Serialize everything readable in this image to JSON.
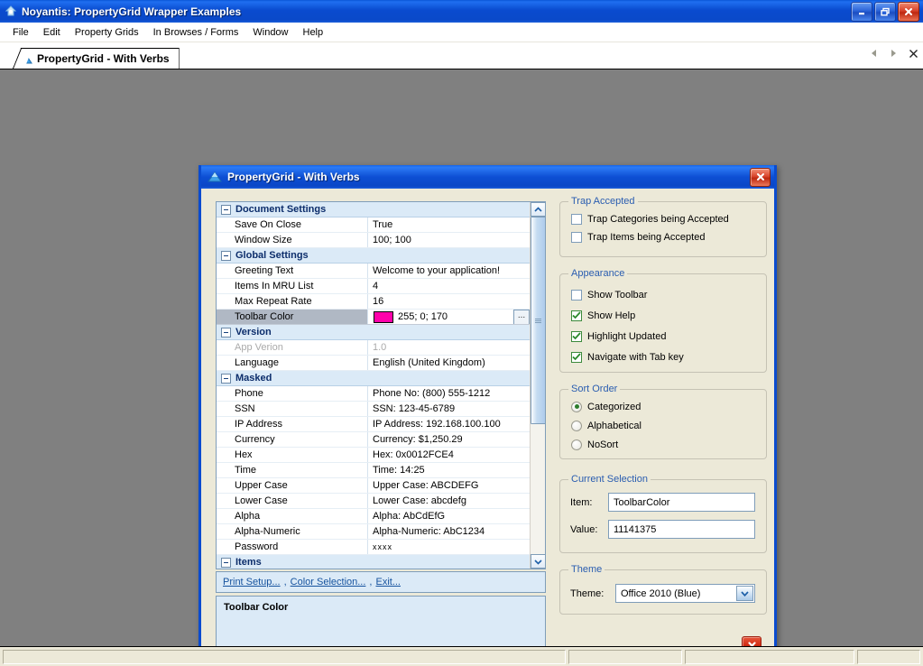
{
  "window": {
    "title": "Noyantis: PropertyGrid Wrapper Examples",
    "icon": "app-icon",
    "buttons": {
      "minimize": "minimize",
      "restore": "restore",
      "close": "close"
    }
  },
  "menubar": {
    "items": [
      {
        "label": "File"
      },
      {
        "label": "Edit"
      },
      {
        "label": "Property Grids"
      },
      {
        "label": "In Browses / Forms"
      },
      {
        "label": "Window"
      },
      {
        "label": "Help"
      }
    ]
  },
  "tabstrip": {
    "tabs": [
      {
        "label": "PropertyGrid - With Verbs",
        "icon": "triangle-icon",
        "active": true
      }
    ],
    "nav": {
      "prev": "prev-arrow-icon",
      "next": "next-arrow-icon",
      "close": "close-icon"
    }
  },
  "dialog": {
    "title": "PropertyGrid - With Verbs",
    "icon": "triangle-icon",
    "close_label": "close",
    "propertygrid": {
      "rows": [
        {
          "type": "category",
          "name": "Document Settings"
        },
        {
          "type": "item",
          "name": "Save On Close",
          "value": "True"
        },
        {
          "type": "item",
          "name": "Window Size",
          "value": "100; 100"
        },
        {
          "type": "category",
          "name": "Global Settings"
        },
        {
          "type": "item",
          "name": "Greeting Text",
          "value": "Welcome to your application!"
        },
        {
          "type": "item",
          "name": "Items In MRU List",
          "value": "4"
        },
        {
          "type": "item",
          "name": "Max Repeat Rate",
          "value": "16"
        },
        {
          "type": "item",
          "name": "Toolbar Color",
          "value": "255; 0; 170",
          "selected": true,
          "swatch": "#FF00AA",
          "editor": "..."
        },
        {
          "type": "category",
          "name": "Version"
        },
        {
          "type": "item",
          "name": "App Verion",
          "value": "1.0",
          "disabled": true
        },
        {
          "type": "item",
          "name": "Language",
          "value": "English (United Kingdom)"
        },
        {
          "type": "category",
          "name": "Masked"
        },
        {
          "type": "item",
          "name": "Phone",
          "value": "Phone No: (800) 555-1212"
        },
        {
          "type": "item",
          "name": "SSN",
          "value": "SSN: 123-45-6789"
        },
        {
          "type": "item",
          "name": "IP Address",
          "value": "IP Address: 192.168.100.100"
        },
        {
          "type": "item",
          "name": "Currency",
          "value": "Currency: $1,250.29"
        },
        {
          "type": "item",
          "name": "Hex",
          "value": "Hex: 0x0012FCE4"
        },
        {
          "type": "item",
          "name": "Time",
          "value": "Time: 14:25"
        },
        {
          "type": "item",
          "name": "Upper Case",
          "value": "Upper Case: ABCDEFG"
        },
        {
          "type": "item",
          "name": "Lower Case",
          "value": "Lower Case: abcdefg"
        },
        {
          "type": "item",
          "name": "Alpha",
          "value": "Alpha: AbCdEfG"
        },
        {
          "type": "item",
          "name": "Alpha-Numeric",
          "value": "Alpha-Numeric: AbC1234"
        },
        {
          "type": "item",
          "name": "Password",
          "value": "xxxx",
          "masked": true
        },
        {
          "type": "category",
          "name": "Items"
        }
      ],
      "scrollbar": {
        "up": "scroll-up-icon",
        "down": "scroll-down-icon"
      }
    },
    "verbs": [
      {
        "label": "Print Setup..."
      },
      {
        "label": "Color Selection..."
      },
      {
        "label": "Exit..."
      }
    ],
    "help": {
      "title": "Toolbar Color",
      "text": ""
    },
    "trap_accepted": {
      "title": "Trap Accepted",
      "checkboxes": [
        {
          "label": "Trap Categories being Accepted",
          "checked": false
        },
        {
          "label": "Trap Items being Accepted",
          "checked": false
        }
      ]
    },
    "appearance": {
      "title": "Appearance",
      "checkboxes": [
        {
          "label": "Show Toolbar",
          "checked": false
        },
        {
          "label": "Show Help",
          "checked": true
        },
        {
          "label": "Highlight Updated",
          "checked": true
        },
        {
          "label": "Navigate with Tab key",
          "checked": true
        }
      ]
    },
    "sort_order": {
      "title": "Sort Order",
      "options": [
        {
          "label": "Categorized",
          "selected": true
        },
        {
          "label": "Alphabetical",
          "selected": false
        },
        {
          "label": "NoSort",
          "selected": false
        }
      ]
    },
    "current_selection": {
      "title": "Current Selection",
      "item_label": "Item:",
      "item_value": "ToolbarColor",
      "value_label": "Value:",
      "value_value": "11141375"
    },
    "theme": {
      "title": "Theme",
      "label": "Theme:",
      "selected": "Office 2010 (Blue)",
      "options": [
        "Office 2010 (Blue)"
      ]
    }
  },
  "statusbar": {
    "panels": [
      "",
      "",
      "",
      ""
    ]
  },
  "colors": {
    "title_blue": "#0a4bcf",
    "dialog_bg": "#ece9d8",
    "category_bg": "#dbeaf7",
    "category_text": "#0c2d6b",
    "swatch": "#FF00AA",
    "link": "#15529e",
    "group_title": "#2a5db0"
  }
}
